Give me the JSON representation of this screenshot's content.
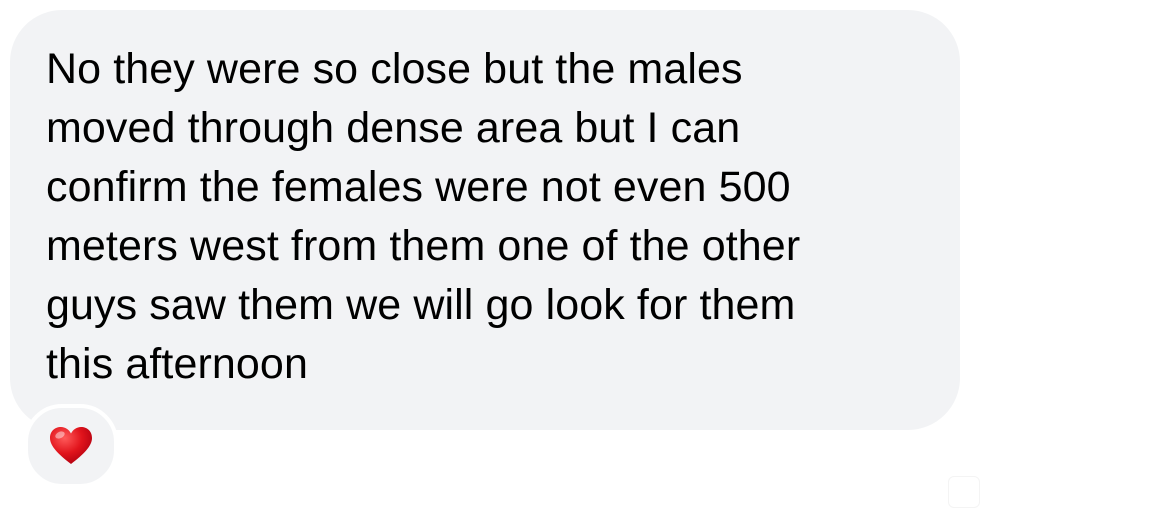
{
  "message": {
    "text": "No they were so close but the males\nmoved through dense area but I can\nconfirm the females were not even 500\nmeters west from them one of the other\nguys saw them we will go look for them\nthis afternoon",
    "bubble_color": "#f2f3f5",
    "text_color": "#000000"
  },
  "reaction": {
    "icon": "red-heart-icon",
    "color": "#e1141c"
  }
}
